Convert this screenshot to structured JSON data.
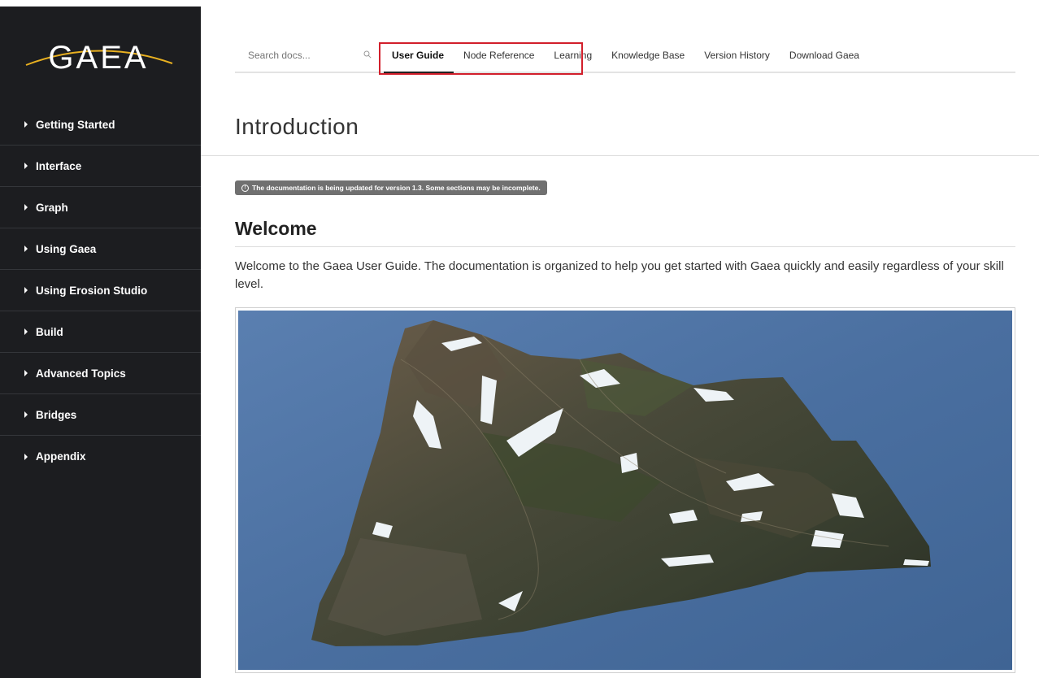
{
  "brand": {
    "logo_text": "GAEA",
    "logo_arc_color": "#e8b020"
  },
  "sidebar": {
    "items": [
      {
        "label": "Getting Started"
      },
      {
        "label": "Interface"
      },
      {
        "label": "Graph"
      },
      {
        "label": "Using Gaea"
      },
      {
        "label": "Using Erosion Studio"
      },
      {
        "label": "Build"
      },
      {
        "label": "Advanced Topics"
      },
      {
        "label": "Bridges"
      },
      {
        "label": "Appendix"
      }
    ]
  },
  "search": {
    "placeholder": "Search docs..."
  },
  "tabs": [
    {
      "label": "User Guide",
      "active": true
    },
    {
      "label": "Node Reference"
    },
    {
      "label": "Learning"
    },
    {
      "label": "Knowledge Base"
    },
    {
      "label": "Version History"
    },
    {
      "label": "Download Gaea"
    }
  ],
  "page": {
    "title": "Introduction",
    "notice": "The documentation is being updated for version 1.3. Some sections may be incomplete.",
    "section_title": "Welcome",
    "intro": "Welcome to the Gaea User Guide. The documentation is organized to help you get started with Gaea quickly and easily regardless of your skill level."
  },
  "colors": {
    "sidebar_bg": "#1c1d20",
    "highlight": "#d21f2b",
    "figure_sky": "#4a6fa0"
  }
}
